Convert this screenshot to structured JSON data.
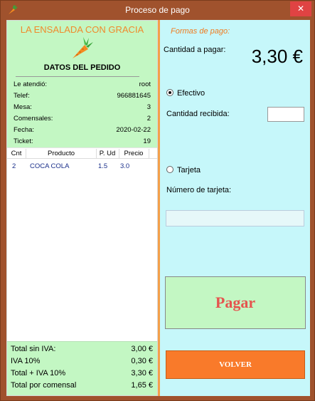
{
  "window": {
    "title": "Proceso de pago",
    "close_label": "✕"
  },
  "order": {
    "brand": "LA ENSALADA CON GRACIA",
    "section_title": "DATOS DEL PEDIDO",
    "info": [
      {
        "label": "Le atendió:",
        "value": "root"
      },
      {
        "label": "Telef:",
        "value": "966881645"
      },
      {
        "label": "Mesa:",
        "value": "3"
      },
      {
        "label": "Comensales:",
        "value": "2"
      },
      {
        "label": "Fecha:",
        "value": "2020-02-22"
      },
      {
        "label": "Ticket:",
        "value": "19"
      }
    ],
    "table": {
      "headers": [
        "Cnt",
        "Producto",
        "P. Ud",
        "Precio"
      ],
      "rows": [
        {
          "cnt": "2",
          "producto": "COCA COLA",
          "pud": "1.5",
          "precio": "3.0"
        }
      ]
    },
    "totals": [
      {
        "label": "Total sin IVA:",
        "value": "3,00 €"
      },
      {
        "label": "IVA 10%",
        "value": "0,30 €"
      },
      {
        "label": "Total + IVA 10%",
        "value": "3,30 €"
      },
      {
        "label": "Total por comensal",
        "value": "1,65 €"
      }
    ]
  },
  "payment": {
    "formas_label": "Formas de pago:",
    "amount_label": "Cantidad a pagar:",
    "amount_value": "3,30 €",
    "efectivo_label": "Efectivo",
    "efectivo_selected": true,
    "recibida_label": "Cantidad recibida:",
    "recibida_value": "",
    "tarjeta_label": "Tarjeta",
    "tarjeta_selected": false,
    "numero_label": "Número de tarjeta:",
    "numero_value": "",
    "pagar_label": "Pagar",
    "volver_label": "VOLVER"
  },
  "colors": {
    "window_frame": "#a0522d",
    "left_panel_bg": "#c3f7c3",
    "right_panel_bg": "#c6f7fa",
    "brand": "#f08a2c",
    "pagar_text": "#e5554f",
    "volver_bg": "#f97a2a",
    "close_bg": "#e04343"
  }
}
